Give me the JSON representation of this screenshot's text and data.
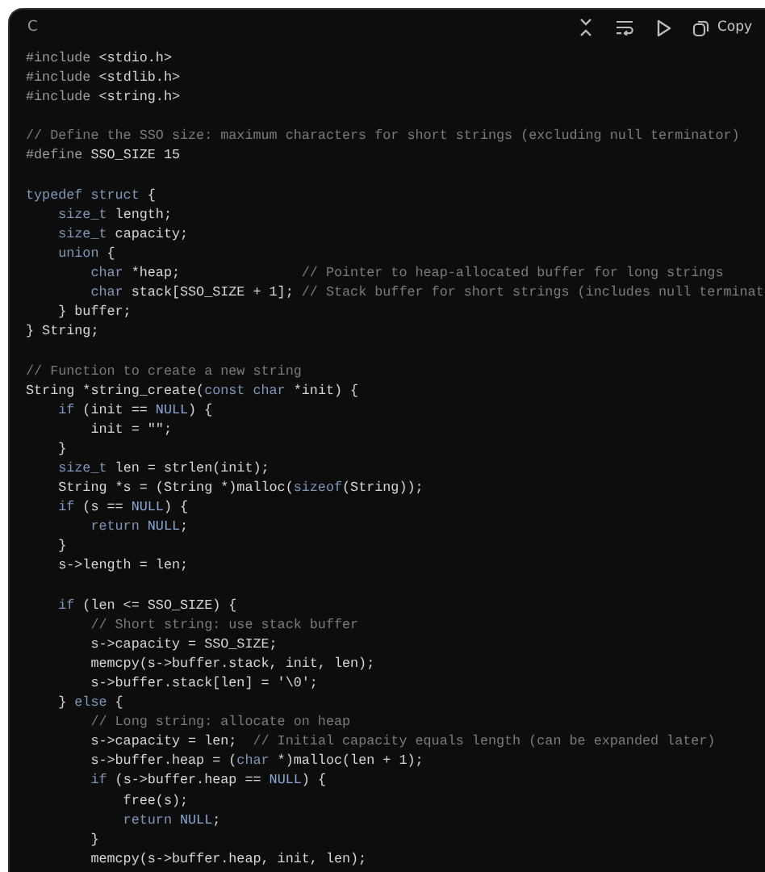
{
  "code_block": {
    "language": "C",
    "copy_label": "Copy",
    "lines": [
      {
        "kind": "code",
        "tokens": [
          {
            "kind": "preproc",
            "text": "#include"
          },
          {
            "kind": "plain",
            "text": " <stdio.h>"
          }
        ]
      },
      {
        "kind": "code",
        "tokens": [
          {
            "kind": "preproc",
            "text": "#include"
          },
          {
            "kind": "plain",
            "text": " <stdlib.h>"
          }
        ]
      },
      {
        "kind": "code",
        "tokens": [
          {
            "kind": "preproc",
            "text": "#include"
          },
          {
            "kind": "plain",
            "text": " <string.h>"
          }
        ]
      },
      {
        "kind": "blank"
      },
      {
        "kind": "code",
        "tokens": [
          {
            "kind": "comment",
            "text": "// Define the SSO size: maximum characters for short strings (excluding null terminator)"
          }
        ]
      },
      {
        "kind": "code",
        "tokens": [
          {
            "kind": "preproc",
            "text": "#define"
          },
          {
            "kind": "plain",
            "text": " SSO_SIZE 15"
          }
        ]
      },
      {
        "kind": "blank"
      },
      {
        "kind": "code",
        "tokens": [
          {
            "kind": "keyword",
            "text": "typedef struct"
          },
          {
            "kind": "plain",
            "text": " {"
          }
        ]
      },
      {
        "kind": "code",
        "tokens": [
          {
            "kind": "keyword",
            "text": "    size_t"
          },
          {
            "kind": "plain",
            "text": " length;"
          }
        ]
      },
      {
        "kind": "code",
        "tokens": [
          {
            "kind": "keyword",
            "text": "    size_t"
          },
          {
            "kind": "plain",
            "text": " capacity;"
          }
        ]
      },
      {
        "kind": "code",
        "tokens": [
          {
            "kind": "keyword",
            "text": "    union"
          },
          {
            "kind": "plain",
            "text": " {"
          }
        ]
      },
      {
        "kind": "code",
        "tokens": [
          {
            "kind": "keyword",
            "text": "        char"
          },
          {
            "kind": "plain",
            "text": " *heap;               "
          },
          {
            "kind": "comment",
            "text": "// Pointer to heap-allocated buffer for long strings"
          }
        ]
      },
      {
        "kind": "code",
        "tokens": [
          {
            "kind": "keyword",
            "text": "        char"
          },
          {
            "kind": "plain",
            "text": " stack[SSO_SIZE + 1]; "
          },
          {
            "kind": "comment",
            "text": "// Stack buffer for short strings (includes null terminat"
          }
        ]
      },
      {
        "kind": "code",
        "tokens": [
          {
            "kind": "plain",
            "text": "    } buffer;"
          }
        ]
      },
      {
        "kind": "code",
        "tokens": [
          {
            "kind": "plain",
            "text": "} String;"
          }
        ]
      },
      {
        "kind": "blank"
      },
      {
        "kind": "code",
        "tokens": [
          {
            "kind": "comment",
            "text": "// Function to create a new string"
          }
        ]
      },
      {
        "kind": "code",
        "tokens": [
          {
            "kind": "plain",
            "text": "String *string_create("
          },
          {
            "kind": "keyword",
            "text": "const char"
          },
          {
            "kind": "plain",
            "text": " *init) {"
          }
        ]
      },
      {
        "kind": "code",
        "tokens": [
          {
            "kind": "keyword",
            "text": "    if"
          },
          {
            "kind": "plain",
            "text": " (init == "
          },
          {
            "kind": "constant",
            "text": "NULL"
          },
          {
            "kind": "plain",
            "text": ") {"
          }
        ]
      },
      {
        "kind": "code",
        "tokens": [
          {
            "kind": "plain",
            "text": "        init = \"\";"
          }
        ]
      },
      {
        "kind": "code",
        "tokens": [
          {
            "kind": "plain",
            "text": "    }"
          }
        ]
      },
      {
        "kind": "code",
        "tokens": [
          {
            "kind": "keyword",
            "text": "    size_t"
          },
          {
            "kind": "plain",
            "text": " len = strlen(init);"
          }
        ]
      },
      {
        "kind": "code",
        "tokens": [
          {
            "kind": "plain",
            "text": "    String *s = (String *)malloc("
          },
          {
            "kind": "keyword",
            "text": "sizeof"
          },
          {
            "kind": "plain",
            "text": "(String));"
          }
        ]
      },
      {
        "kind": "code",
        "tokens": [
          {
            "kind": "keyword",
            "text": "    if"
          },
          {
            "kind": "plain",
            "text": " (s == "
          },
          {
            "kind": "constant",
            "text": "NULL"
          },
          {
            "kind": "plain",
            "text": ") {"
          }
        ]
      },
      {
        "kind": "code",
        "tokens": [
          {
            "kind": "keyword",
            "text": "        return "
          },
          {
            "kind": "constant",
            "text": "NULL"
          },
          {
            "kind": "plain",
            "text": ";"
          }
        ]
      },
      {
        "kind": "code",
        "tokens": [
          {
            "kind": "plain",
            "text": "    }"
          }
        ]
      },
      {
        "kind": "code",
        "tokens": [
          {
            "kind": "plain",
            "text": "    s->length = len;"
          }
        ]
      },
      {
        "kind": "blank"
      },
      {
        "kind": "code",
        "tokens": [
          {
            "kind": "keyword",
            "text": "    if"
          },
          {
            "kind": "plain",
            "text": " (len <= SSO_SIZE) {"
          }
        ]
      },
      {
        "kind": "code",
        "tokens": [
          {
            "kind": "comment",
            "text": "        // Short string: use stack buffer"
          }
        ]
      },
      {
        "kind": "code",
        "tokens": [
          {
            "kind": "plain",
            "text": "        s->capacity = SSO_SIZE;"
          }
        ]
      },
      {
        "kind": "code",
        "tokens": [
          {
            "kind": "plain",
            "text": "        memcpy(s->buffer.stack, init, len);"
          }
        ]
      },
      {
        "kind": "code",
        "tokens": [
          {
            "kind": "plain",
            "text": "        s->buffer.stack[len] = '\\0';"
          }
        ]
      },
      {
        "kind": "code",
        "tokens": [
          {
            "kind": "plain",
            "text": "    } "
          },
          {
            "kind": "keyword",
            "text": "else"
          },
          {
            "kind": "plain",
            "text": " {"
          }
        ]
      },
      {
        "kind": "code",
        "tokens": [
          {
            "kind": "comment",
            "text": "        // Long string: allocate on heap"
          }
        ]
      },
      {
        "kind": "code",
        "tokens": [
          {
            "kind": "plain",
            "text": "        s->capacity = len;  "
          },
          {
            "kind": "comment",
            "text": "// Initial capacity equals length (can be expanded later)"
          }
        ]
      },
      {
        "kind": "code",
        "tokens": [
          {
            "kind": "plain",
            "text": "        s->buffer.heap = ("
          },
          {
            "kind": "keyword",
            "text": "char"
          },
          {
            "kind": "plain",
            "text": " *)malloc(len + 1);"
          }
        ]
      },
      {
        "kind": "code",
        "tokens": [
          {
            "kind": "keyword",
            "text": "        if"
          },
          {
            "kind": "plain",
            "text": " (s->buffer.heap == "
          },
          {
            "kind": "constant",
            "text": "NULL"
          },
          {
            "kind": "plain",
            "text": ") {"
          }
        ]
      },
      {
        "kind": "code",
        "tokens": [
          {
            "kind": "plain",
            "text": "            free(s);"
          }
        ]
      },
      {
        "kind": "code",
        "tokens": [
          {
            "kind": "keyword",
            "text": "            return "
          },
          {
            "kind": "constant",
            "text": "NULL"
          },
          {
            "kind": "plain",
            "text": ";"
          }
        ]
      },
      {
        "kind": "code",
        "tokens": [
          {
            "kind": "plain",
            "text": "        }"
          }
        ]
      },
      {
        "kind": "code",
        "tokens": [
          {
            "kind": "plain",
            "text": "        memcpy(s->buffer.heap, init, len);"
          }
        ]
      }
    ]
  }
}
